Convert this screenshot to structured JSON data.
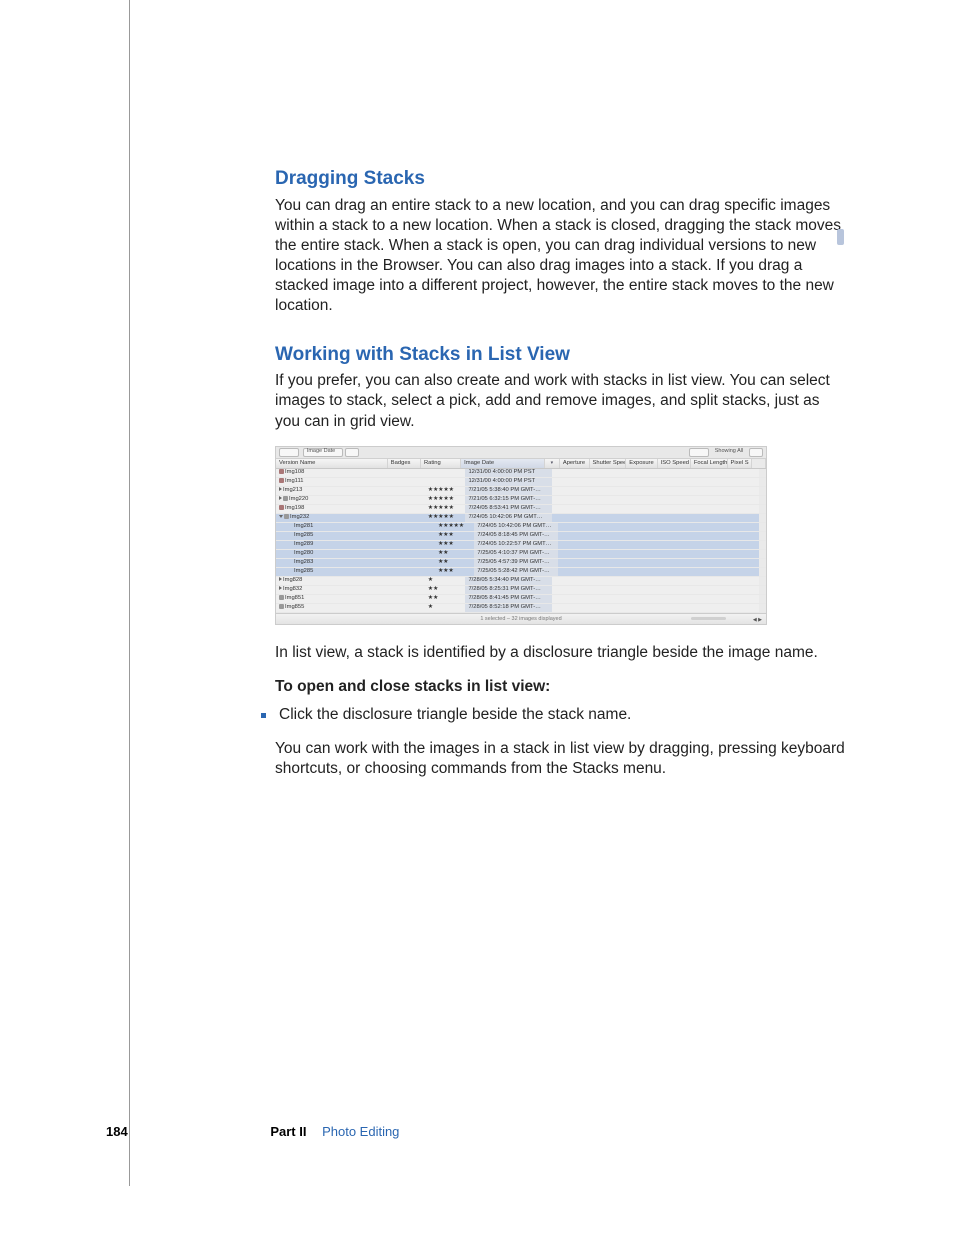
{
  "section1": {
    "title": "Dragging Stacks",
    "body": "You can drag an entire stack to a new location, and you can drag specific images within a stack to a new location. When a stack is closed, dragging the stack moves the entire stack. When a stack is open, you can drag individual versions to new locations in the Browser. You can also drag images into a stack. If you drag a stacked image into a different project, however, the entire stack moves to the new location."
  },
  "section2": {
    "title": "Working with Stacks in List View",
    "intro": "If you prefer, you can also create and work with stacks in list view. You can select images to stack, select a pick, add and remove images, and split stacks, just as you can in grid view.",
    "after_mock": "In list view, a stack is identified by a disclosure triangle beside the image name.",
    "howto_label": "To open and close stacks in list view:",
    "bullet": "Click the disclosure triangle beside the stack name.",
    "after_bullet": "You can work with the images in a stack in list view by dragging, pressing keyboard shortcuts, or choosing commands from the Stacks menu."
  },
  "mock": {
    "toolbar": {
      "sortfield": "Image Date",
      "showing": "Showing All"
    },
    "headers": {
      "name": "Version Name",
      "badges": "Badges",
      "rating": "Rating",
      "date": "Image Date",
      "aperture": "Aperture",
      "shutter": "Shutter Speed",
      "exposure": "Exposure",
      "iso": "ISO Speed",
      "focal": "Focal Length",
      "pixel": "Pixel S"
    },
    "rows": [
      {
        "tri": "",
        "icon": "badge",
        "indent": 0,
        "name": "Img108",
        "rating": "",
        "date": "12/31/00 4:00:00 PM PST"
      },
      {
        "tri": "",
        "icon": "badge",
        "indent": 0,
        "name": "Img111",
        "rating": "",
        "date": "12/31/00 4:00:00 PM PST"
      },
      {
        "tri": "closed",
        "icon": "",
        "indent": 0,
        "name": "Img213",
        "rating": "★★★★★",
        "date": "7/21/05 5:38:40 PM GMT-…"
      },
      {
        "tri": "closed",
        "icon": "stack",
        "indent": 0,
        "name": "Img220",
        "rating": "★★★★★",
        "date": "7/21/05 6:32:15 PM GMT-…"
      },
      {
        "tri": "",
        "icon": "badge",
        "indent": 0,
        "name": "Img198",
        "rating": "★★★★★",
        "date": "7/24/05 8:53:41 PM GMT-…"
      },
      {
        "tri": "open",
        "icon": "stack",
        "indent": 0,
        "name": "Img232",
        "rating": "★★★★★",
        "date": "7/24/05 10:42:06 PM GMT…",
        "sel": true
      },
      {
        "tri": "",
        "icon": "",
        "indent": 1,
        "name": "Img281",
        "rating": "★★★★★",
        "date": "7/24/05 10:42:06 PM GMT…",
        "sel": true
      },
      {
        "tri": "",
        "icon": "",
        "indent": 1,
        "name": "Img285",
        "rating": "★★★",
        "date": "7/24/05 8:18:45 PM GMT-…",
        "sel": true
      },
      {
        "tri": "",
        "icon": "",
        "indent": 1,
        "name": "Img289",
        "rating": "★★★",
        "date": "7/24/05 10:22:57 PM GMT…",
        "sel": true
      },
      {
        "tri": "",
        "icon": "",
        "indent": 1,
        "name": "Img280",
        "rating": "★★",
        "date": "7/25/05 4:10:37 PM GMT-…",
        "sel": true
      },
      {
        "tri": "",
        "icon": "",
        "indent": 1,
        "name": "Img283",
        "rating": "★★",
        "date": "7/25/05 4:57:39 PM GMT-…",
        "sel": true
      },
      {
        "tri": "",
        "icon": "",
        "indent": 1,
        "name": "Img285",
        "rating": "★★★",
        "date": "7/25/05 5:28:42 PM GMT-…",
        "sel": true
      },
      {
        "tri": "closed",
        "icon": "",
        "indent": 0,
        "name": "Img828",
        "rating": "★",
        "date": "7/28/05 5:34:40 PM GMT-…"
      },
      {
        "tri": "closed",
        "icon": "",
        "indent": 0,
        "name": "Img832",
        "rating": "★★",
        "date": "7/28/05 8:25:31 PM GMT-…"
      },
      {
        "tri": "",
        "icon": "stack",
        "indent": 0,
        "name": "Img851",
        "rating": "★★",
        "date": "7/28/05 8:41:45 PM GMT-…"
      },
      {
        "tri": "",
        "icon": "stack",
        "indent": 0,
        "name": "Img855",
        "rating": "★",
        "date": "7/28/05 8:52:18 PM GMT-…"
      }
    ],
    "footer": "1 selected – 32 images displayed"
  },
  "footer": {
    "page": "184",
    "part": "Part II",
    "partname": "Photo Editing"
  }
}
